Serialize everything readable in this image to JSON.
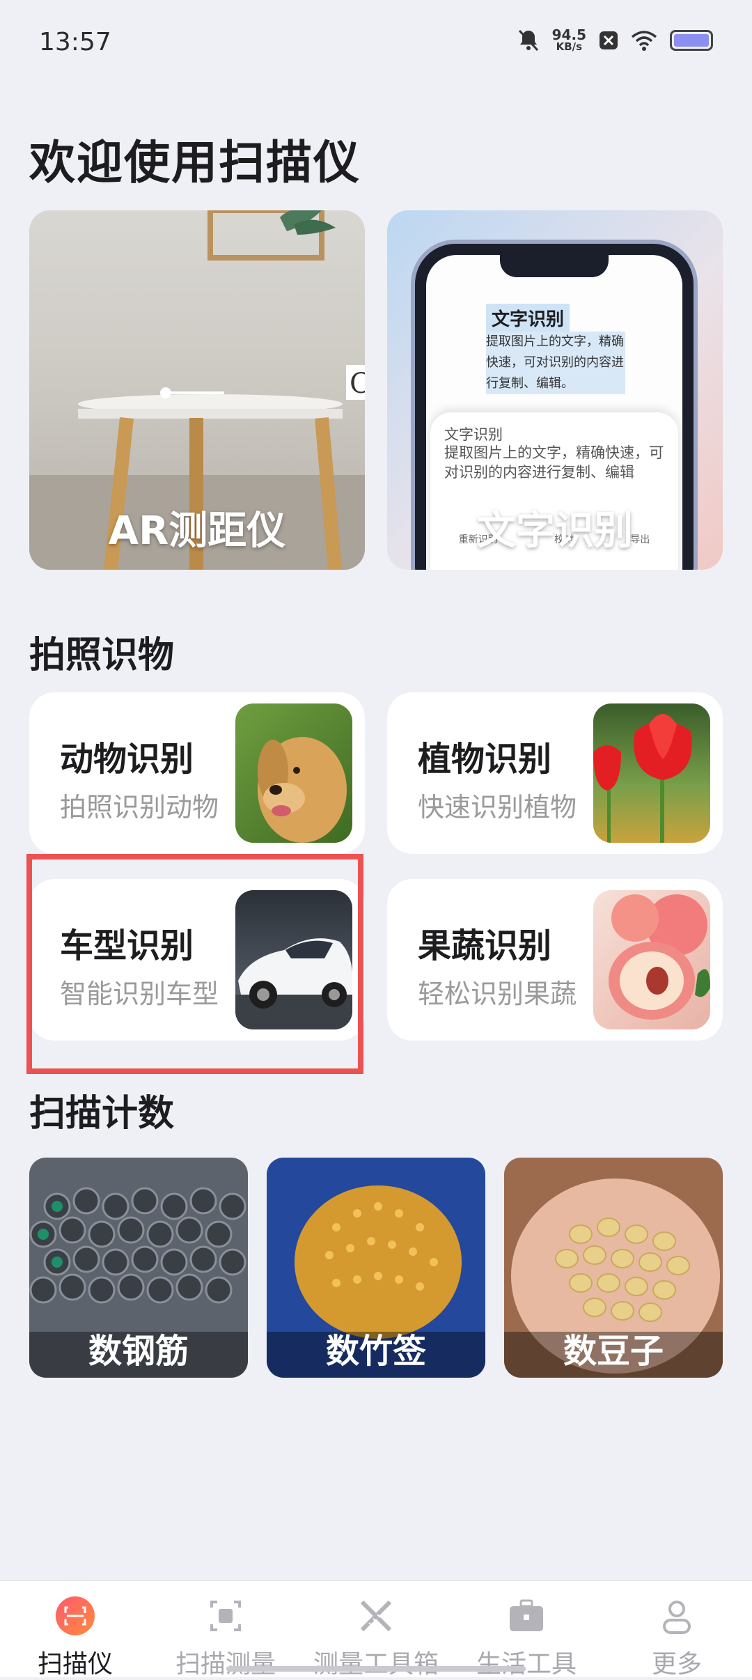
{
  "status_bar": {
    "time": "13:57",
    "net_speed_value": "94.5",
    "net_speed_unit": "KB/s",
    "icons": [
      "mute-bell-icon",
      "close-box-icon",
      "wifi-icon",
      "battery-icon"
    ]
  },
  "page_title": "欢迎使用扫描仪",
  "hero_cards": [
    {
      "label": "AR测距仪"
    },
    {
      "label": "文字识别"
    }
  ],
  "ocr_mock": {
    "header": "文字识别",
    "highlight_text": "提取图片上的文字，精确快速，可对识别的内容进行复制、编辑。",
    "sheet_title": "文字识别",
    "sheet_text": "提取图片上的文字，精确快速，可对识别的内容进行复制、编辑",
    "actions": [
      "重新识别",
      "校对",
      "导出"
    ]
  },
  "section_photo": {
    "title": "拍照识物"
  },
  "photo_cards": [
    {
      "name": "动物识别",
      "desc": "拍照识别动物"
    },
    {
      "name": "植物识别",
      "desc": "快速识别植物"
    },
    {
      "name": "车型识别",
      "desc": "智能识别车型"
    },
    {
      "name": "果蔬识别",
      "desc": "轻松识别果蔬"
    }
  ],
  "section_count": {
    "title": "扫描计数"
  },
  "count_tiles": [
    {
      "label": "数钢筋"
    },
    {
      "label": "数竹签"
    },
    {
      "label": "数豆子"
    }
  ],
  "tab_bar": {
    "active_index": 0,
    "tabs": [
      {
        "label": "扫描仪",
        "icon": "scanner-icon"
      },
      {
        "label": "扫描测量",
        "icon": "scan-measure-icon"
      },
      {
        "label": "测量工具箱",
        "icon": "ruler-tools-icon"
      },
      {
        "label": "生活工具",
        "icon": "toolbox-icon"
      },
      {
        "label": "更多",
        "icon": "person-icon"
      }
    ]
  },
  "colors": {
    "background": "#eef0f5",
    "accent_red": "#ea5352",
    "active_tab_gradient": [
      "#ff5a6e",
      "#ff8a3d"
    ],
    "inactive_tab": "#a8a8ae"
  }
}
